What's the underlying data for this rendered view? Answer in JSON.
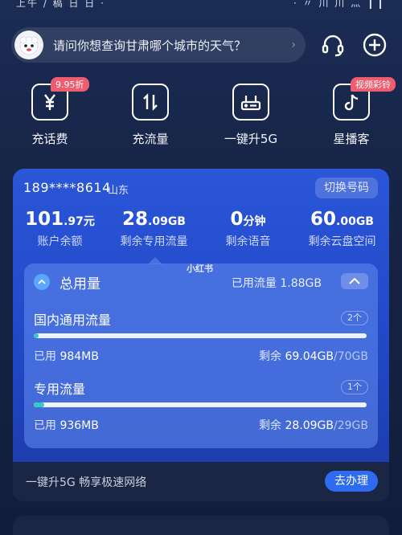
{
  "status_bar": {
    "left": "上午 / 稿 日 日 ·",
    "right": "· 〃 川 川 灬 ❙❙"
  },
  "search": {
    "prompt": "请问你想查询甘肃哪个城市的天气？"
  },
  "header_icons": {
    "service": "headset-icon",
    "add": "plus-circle-icon"
  },
  "quick_actions": [
    {
      "label": "充话费",
      "icon": "yuan-icon",
      "tag": "9.95折"
    },
    {
      "label": "充流量",
      "icon": "data-arrows-icon",
      "tag": ""
    },
    {
      "label": "一键升5G",
      "icon": "router-5g-icon",
      "tag": ""
    },
    {
      "label": "星播客",
      "icon": "music-note-icon",
      "tag": "视频彩铃"
    }
  ],
  "account": {
    "phone": "189****8614",
    "province": "山东",
    "switch_label": "切换号码",
    "stats": [
      {
        "value": "101",
        "value_small": ".97元",
        "caption": "账户余额"
      },
      {
        "value": "28",
        "value_small": ".09GB",
        "caption": "剩余专用流量"
      },
      {
        "value": "0",
        "value_small": "分钟",
        "caption": "剩余语音"
      },
      {
        "value": "60",
        "value_small": ".00GB",
        "caption": "剩余云盘空间"
      }
    ]
  },
  "usage": {
    "title": "总用量",
    "used_label": "已用流量",
    "used_value": "1.88GB",
    "watermark": "小红书",
    "packages": [
      {
        "name": "国内通用流量",
        "count": "2个",
        "used_prefix": "已用",
        "used": "984MB",
        "remain_prefix": "剩余",
        "remain": "69.04GB",
        "total": "/70GB",
        "fill_percent": 1.4
      },
      {
        "name": "专用流量",
        "count": "1个",
        "used_prefix": "已用",
        "used": "936MB",
        "remain_prefix": "剩余",
        "remain": "28.09GB",
        "total": "/29GB",
        "fill_percent": 3.2
      }
    ]
  },
  "promo": {
    "text": "一键升5G    畅享极速网络",
    "button": "去办理"
  },
  "colors": {
    "card": "#2a56d8",
    "progress": "#33c9c7",
    "tag": "#ee5d6f",
    "button": "#2f6bf0"
  }
}
